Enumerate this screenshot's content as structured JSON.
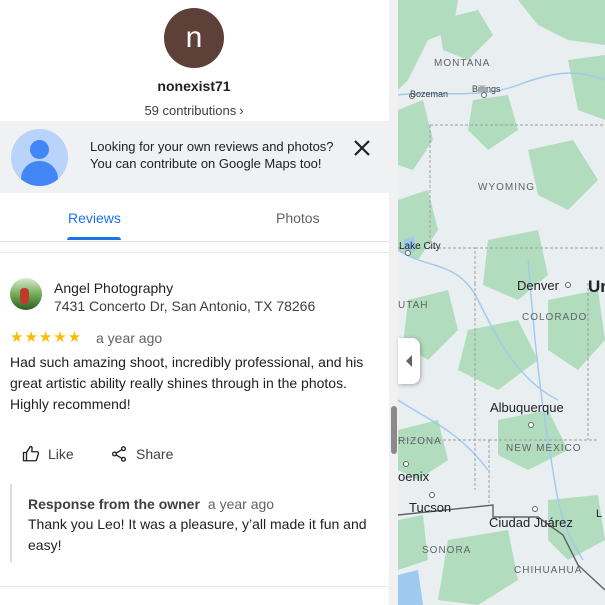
{
  "profile": {
    "initial": "n",
    "username": "nonexist71",
    "contributions": "59 contributions",
    "contributions_chevron": "›"
  },
  "banner": {
    "line1": "Looking for your own reviews and photos?",
    "line2": "You can contribute on Google Maps too!",
    "close_icon": "close-icon"
  },
  "tabs": [
    {
      "label": "Reviews",
      "active": true
    },
    {
      "label": "Photos",
      "active": false
    }
  ],
  "review": {
    "name": "Angel Photography",
    "address": "7431 Concerto Dr, San Antonio, TX 78266",
    "stars": "★★★★★",
    "rating": 5,
    "date": "a year ago",
    "text": "Had such amazing shoot, incredibly professional, and his great artistic ability really shines through in the photos. Highly recommend!",
    "like_label": "Like",
    "share_label": "Share",
    "owner_response": {
      "title": "Response from the owner",
      "date": "a year ago",
      "text": "Thank you Leo! It was a pleasure, y’all made it fun and easy!"
    }
  },
  "map": {
    "labels": {
      "montana": "MONTANA",
      "bozeman": "Bozeman",
      "billings": "Billings",
      "wyoming": "WYOMING",
      "lake_city": "Lake City",
      "denver": "Denver",
      "un": "Un",
      "utah": "UTAH",
      "colorado": "COLORADO",
      "albuquerque": "Albuquerque",
      "arizona": "RIZONA",
      "new_mexico": "NEW MEXICO",
      "phoenix": "oenix",
      "tucson": "Tucson",
      "ciudad_juarez": "Ciudad Juárez",
      "sonora": "SONORA",
      "chihuahua": "CHIHUAHUA",
      "l": "L"
    },
    "colors": {
      "land": "#e9eef0",
      "forest": "#a8dab5",
      "water": "#9ecaf0",
      "border": "#9aa0a6"
    }
  }
}
